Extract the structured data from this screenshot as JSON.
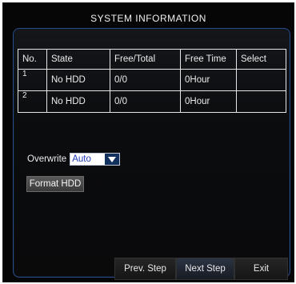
{
  "window": {
    "title": "SYSTEM INFORMATION"
  },
  "table": {
    "headers": [
      "No.",
      "State",
      "Free/Total",
      "Free Time",
      "Select"
    ],
    "rows": [
      {
        "no": "1",
        "state": "No HDD",
        "free_total": "0/0",
        "free_time": "0Hour",
        "select": ""
      },
      {
        "no": "2",
        "state": "No HDD",
        "free_total": "0/0",
        "free_time": "0Hour",
        "select": ""
      }
    ]
  },
  "overwrite": {
    "label": "Overwrite",
    "value": "Auto"
  },
  "buttons": {
    "format": "Format HDD",
    "prev": "Prev. Step",
    "next": "Next Step",
    "exit": "Exit"
  },
  "colors": {
    "panel_border": "#2a4d85",
    "select_text": "#1d38b8"
  },
  "icons": {
    "dropdown": "triangle-down-icon"
  }
}
